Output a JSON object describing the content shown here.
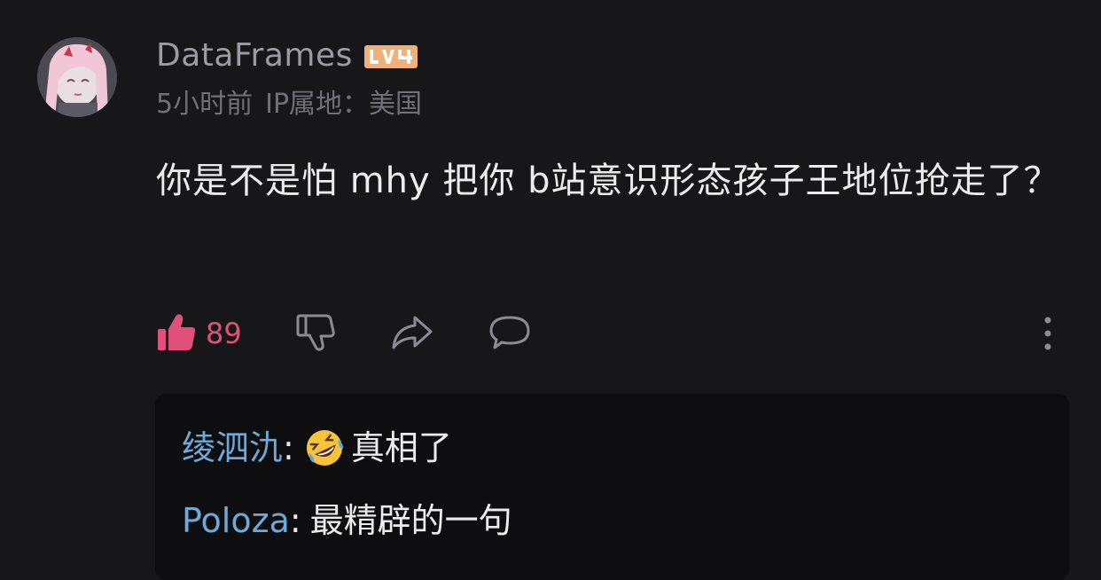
{
  "comment": {
    "author": "DataFrames",
    "level": "LV4",
    "time": "5小时前",
    "ip_location": "IP属地：美国",
    "text": "你是不是怕 mhy 把你 b站意识形态孩子王地位抢走了？"
  },
  "actions": {
    "like_count": "89",
    "like_color": "#e0507a"
  },
  "replies": [
    {
      "name": "绫泗氿",
      "emoji": "rolling-on-floor-laughing",
      "text": "真相了"
    },
    {
      "name": "Poloza",
      "text": "最精辟的一句"
    }
  ],
  "colors": {
    "background": "#17171a",
    "reply_box": "#0e0e10",
    "reply_name": "#6ea9d7",
    "level_badge": "#f0b07a"
  },
  "icons": [
    "avatar",
    "level-badge",
    "thumbs-up-icon",
    "thumbs-down-icon",
    "share-icon",
    "comment-icon",
    "more-vertical-icon",
    "laughing-emoji-icon"
  ]
}
